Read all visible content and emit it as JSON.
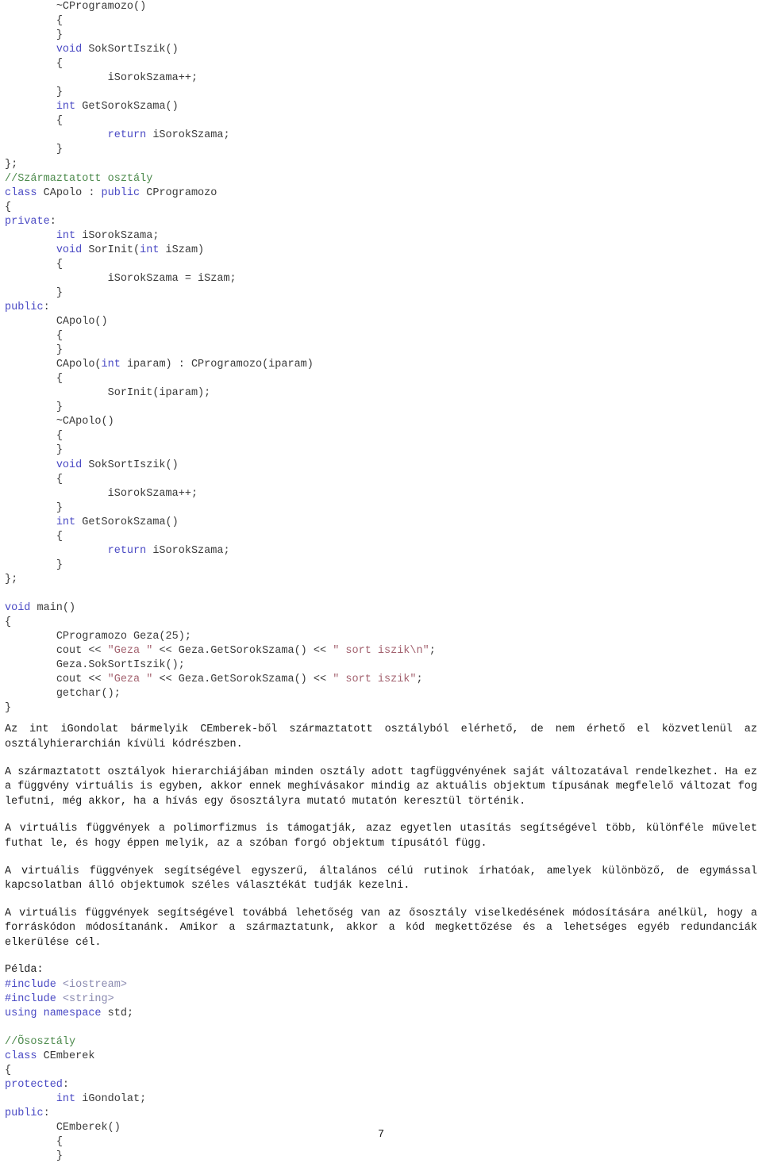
{
  "page": {
    "number": "7",
    "language": "hu",
    "colors": {
      "keyword": "#4a4ac4",
      "comment": "#4c8a4c",
      "string": "#a3626f",
      "header": "#8a8ab0",
      "identifier": "#3a3a3a",
      "prose": "#1d1d1d",
      "background": "#ffffff"
    }
  },
  "code_top": {
    "lines": [
      [
        {
          "t": "        ",
          "c": "punct"
        },
        {
          "t": "~CProgramozo()",
          "c": "id"
        }
      ],
      [
        {
          "t": "        ",
          "c": "punct"
        },
        {
          "t": "{",
          "c": "punct"
        }
      ],
      [
        {
          "t": "        ",
          "c": "punct"
        },
        {
          "t": "}",
          "c": "punct"
        }
      ],
      [
        {
          "t": "        ",
          "c": "punct"
        },
        {
          "t": "void",
          "c": "kw"
        },
        {
          "t": " SokSortIszik()",
          "c": "id"
        }
      ],
      [
        {
          "t": "        ",
          "c": "punct"
        },
        {
          "t": "{",
          "c": "punct"
        }
      ],
      [
        {
          "t": "                ",
          "c": "punct"
        },
        {
          "t": "iSorokSzama++;",
          "c": "id"
        }
      ],
      [
        {
          "t": "        ",
          "c": "punct"
        },
        {
          "t": "}",
          "c": "punct"
        }
      ],
      [
        {
          "t": "        ",
          "c": "punct"
        },
        {
          "t": "int",
          "c": "kw"
        },
        {
          "t": " GetSorokSzama()",
          "c": "id"
        }
      ],
      [
        {
          "t": "        ",
          "c": "punct"
        },
        {
          "t": "{",
          "c": "punct"
        }
      ],
      [
        {
          "t": "                ",
          "c": "punct"
        },
        {
          "t": "return",
          "c": "kw"
        },
        {
          "t": " iSorokSzama;",
          "c": "id"
        }
      ],
      [
        {
          "t": "        ",
          "c": "punct"
        },
        {
          "t": "}",
          "c": "punct"
        }
      ],
      [
        {
          "t": "};",
          "c": "punct"
        }
      ],
      [
        {
          "t": "//Származtatott osztály",
          "c": "cmt"
        }
      ],
      [
        {
          "t": "class",
          "c": "kw"
        },
        {
          "t": " CApolo : ",
          "c": "id"
        },
        {
          "t": "public",
          "c": "kw"
        },
        {
          "t": " CProgramozo",
          "c": "id"
        }
      ],
      [
        {
          "t": "{",
          "c": "punct"
        }
      ],
      [
        {
          "t": "private",
          "c": "kw"
        },
        {
          "t": ":",
          "c": "punct"
        }
      ],
      [
        {
          "t": "        ",
          "c": "punct"
        },
        {
          "t": "int",
          "c": "kw"
        },
        {
          "t": " iSorokSzama;",
          "c": "id"
        }
      ],
      [
        {
          "t": "        ",
          "c": "punct"
        },
        {
          "t": "void",
          "c": "kw"
        },
        {
          "t": " SorInit(",
          "c": "id"
        },
        {
          "t": "int",
          "c": "kw"
        },
        {
          "t": " iSzam)",
          "c": "id"
        }
      ],
      [
        {
          "t": "        ",
          "c": "punct"
        },
        {
          "t": "{",
          "c": "punct"
        }
      ],
      [
        {
          "t": "                ",
          "c": "punct"
        },
        {
          "t": "iSorokSzama = iSzam;",
          "c": "id"
        }
      ],
      [
        {
          "t": "        ",
          "c": "punct"
        },
        {
          "t": "}",
          "c": "punct"
        }
      ],
      [
        {
          "t": "public",
          "c": "kw"
        },
        {
          "t": ":",
          "c": "punct"
        }
      ],
      [
        {
          "t": "        ",
          "c": "punct"
        },
        {
          "t": "CApolo()",
          "c": "id"
        }
      ],
      [
        {
          "t": "        ",
          "c": "punct"
        },
        {
          "t": "{",
          "c": "punct"
        }
      ],
      [
        {
          "t": "        ",
          "c": "punct"
        },
        {
          "t": "}",
          "c": "punct"
        }
      ],
      [
        {
          "t": "        ",
          "c": "punct"
        },
        {
          "t": "CApolo(",
          "c": "id"
        },
        {
          "t": "int",
          "c": "kw"
        },
        {
          "t": " iparam) : CProgramozo(iparam)",
          "c": "id"
        }
      ],
      [
        {
          "t": "        ",
          "c": "punct"
        },
        {
          "t": "{",
          "c": "punct"
        }
      ],
      [
        {
          "t": "                ",
          "c": "punct"
        },
        {
          "t": "SorInit(iparam);",
          "c": "id"
        }
      ],
      [
        {
          "t": "        ",
          "c": "punct"
        },
        {
          "t": "}",
          "c": "punct"
        }
      ],
      [
        {
          "t": "        ",
          "c": "punct"
        },
        {
          "t": "~CApolo()",
          "c": "id"
        }
      ],
      [
        {
          "t": "        ",
          "c": "punct"
        },
        {
          "t": "{",
          "c": "punct"
        }
      ],
      [
        {
          "t": "        ",
          "c": "punct"
        },
        {
          "t": "}",
          "c": "punct"
        }
      ],
      [
        {
          "t": "        ",
          "c": "punct"
        },
        {
          "t": "void",
          "c": "kw"
        },
        {
          "t": " SokSortIszik()",
          "c": "id"
        }
      ],
      [
        {
          "t": "        ",
          "c": "punct"
        },
        {
          "t": "{",
          "c": "punct"
        }
      ],
      [
        {
          "t": "                ",
          "c": "punct"
        },
        {
          "t": "iSorokSzama++;",
          "c": "id"
        }
      ],
      [
        {
          "t": "        ",
          "c": "punct"
        },
        {
          "t": "}",
          "c": "punct"
        }
      ],
      [
        {
          "t": "        ",
          "c": "punct"
        },
        {
          "t": "int",
          "c": "kw"
        },
        {
          "t": " GetSorokSzama()",
          "c": "id"
        }
      ],
      [
        {
          "t": "        ",
          "c": "punct"
        },
        {
          "t": "{",
          "c": "punct"
        }
      ],
      [
        {
          "t": "                ",
          "c": "punct"
        },
        {
          "t": "return",
          "c": "kw"
        },
        {
          "t": " iSorokSzama;",
          "c": "id"
        }
      ],
      [
        {
          "t": "        ",
          "c": "punct"
        },
        {
          "t": "}",
          "c": "punct"
        }
      ],
      [
        {
          "t": "};",
          "c": "punct"
        }
      ],
      [
        {
          "t": "",
          "c": "punct"
        }
      ],
      [
        {
          "t": "void",
          "c": "kw"
        },
        {
          "t": " main()",
          "c": "id"
        }
      ],
      [
        {
          "t": "{",
          "c": "punct"
        }
      ],
      [
        {
          "t": "        ",
          "c": "punct"
        },
        {
          "t": "CProgramozo Geza(25);",
          "c": "id"
        }
      ],
      [
        {
          "t": "        ",
          "c": "punct"
        },
        {
          "t": "cout << ",
          "c": "id"
        },
        {
          "t": "\"Geza \"",
          "c": "str"
        },
        {
          "t": " << Geza.GetSorokSzama() << ",
          "c": "id"
        },
        {
          "t": "\" sort iszik\\n\"",
          "c": "str"
        },
        {
          "t": ";",
          "c": "id"
        }
      ],
      [
        {
          "t": "        ",
          "c": "punct"
        },
        {
          "t": "Geza.SokSortIszik();",
          "c": "id"
        }
      ],
      [
        {
          "t": "        ",
          "c": "punct"
        },
        {
          "t": "cout << ",
          "c": "id"
        },
        {
          "t": "\"Geza \"",
          "c": "str"
        },
        {
          "t": " << Geza.GetSorokSzama() << ",
          "c": "id"
        },
        {
          "t": "\" sort iszik\"",
          "c": "str"
        },
        {
          "t": ";",
          "c": "id"
        }
      ],
      [
        {
          "t": "        ",
          "c": "punct"
        },
        {
          "t": "getchar();",
          "c": "id"
        }
      ],
      [
        {
          "t": "}",
          "c": "punct"
        }
      ]
    ]
  },
  "prose": {
    "paragraphs": [
      "Az int iGondolat bármelyik CEmberek-ből származtatott osztályból elérhető, de nem érhető el közvetlenül az osztályhierarchián kívüli kódrészben.",
      "A származtatott osztályok hierarchiájában minden osztály adott tagfüggvényének saját változatával rendelkezhet. Ha ez a függvény virtuális is egyben, akkor ennek meghívásakor mindig az aktuális objektum típusának megfelelő változat fog lefutni, még akkor, ha a hívás egy ősosztályra mutató mutatón keresztül történik.",
      "A virtuális függvények a polimorfizmus is támogatják, azaz egyetlen utasítás segítségével több,  különféle művelet futhat le, és hogy éppen melyik, az a szóban forgó objektum típusától függ.",
      "A virtuális függvények segítségével egyszerű, általános célú rutinok írhatóak, amelyek különböző, de egymással kapcsolatban álló objektumok széles választékát tudják kezelni.",
      "A virtuális függvények segítségével továbbá lehetőség van az ősosztály viselkedésének módosítására anélkül, hogy a forráskódon módosítanánk. Amikor a származtatunk, akkor a kód megkettőzése és a lehetséges egyéb redundanciák elkerülése cél."
    ]
  },
  "example_label": "Példa:",
  "code_bottom": {
    "lines": [
      [
        {
          "t": "#include",
          "c": "pre"
        },
        {
          "t": " ",
          "c": "id"
        },
        {
          "t": "<iostream>",
          "c": "header"
        }
      ],
      [
        {
          "t": "#include",
          "c": "pre"
        },
        {
          "t": " ",
          "c": "id"
        },
        {
          "t": "<string>",
          "c": "header"
        }
      ],
      [
        {
          "t": "using",
          "c": "kw"
        },
        {
          "t": " ",
          "c": "id"
        },
        {
          "t": "namespace",
          "c": "kw"
        },
        {
          "t": " std;",
          "c": "id"
        }
      ],
      [
        {
          "t": "",
          "c": "punct"
        }
      ],
      [
        {
          "t": "//Õsosztály",
          "c": "cmt"
        }
      ],
      [
        {
          "t": "class",
          "c": "kw"
        },
        {
          "t": " CEmberek",
          "c": "id"
        }
      ],
      [
        {
          "t": "{",
          "c": "punct"
        }
      ],
      [
        {
          "t": "protected",
          "c": "kw"
        },
        {
          "t": ":",
          "c": "punct"
        }
      ],
      [
        {
          "t": "        ",
          "c": "punct"
        },
        {
          "t": "int",
          "c": "kw"
        },
        {
          "t": " iGondolat;",
          "c": "id"
        }
      ],
      [
        {
          "t": "public",
          "c": "kw"
        },
        {
          "t": ":",
          "c": "punct"
        }
      ],
      [
        {
          "t": "        ",
          "c": "punct"
        },
        {
          "t": "CEmberek()",
          "c": "id"
        }
      ],
      [
        {
          "t": "        ",
          "c": "punct"
        },
        {
          "t": "{",
          "c": "punct"
        }
      ],
      [
        {
          "t": "        ",
          "c": "punct"
        },
        {
          "t": "}",
          "c": "punct"
        }
      ]
    ]
  }
}
